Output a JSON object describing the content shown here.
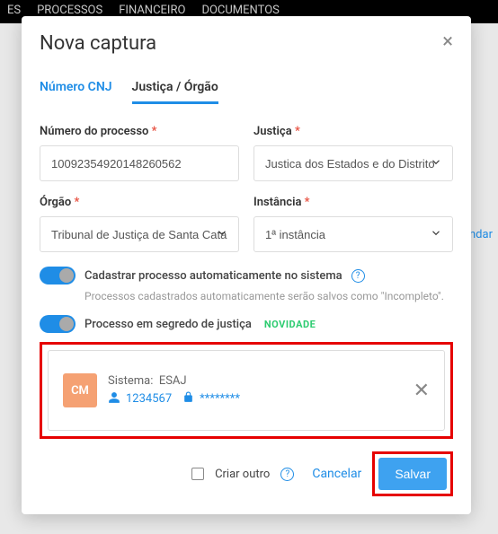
{
  "topnav": {
    "item1": "ES",
    "item2": "PROCESSOS",
    "item3": "FINANCEIRO",
    "item4": "DOCUMENTOS"
  },
  "sideLink": "ndar",
  "modal": {
    "title": "Nova captura",
    "close": "×",
    "tabs": {
      "cnj": "Número CNJ",
      "justica": "Justiça / Órgão"
    },
    "fields": {
      "numero": {
        "label": "Número do processo",
        "value": "10092354920148260562"
      },
      "justica": {
        "label": "Justiça",
        "value": "Justica dos Estados e do Distrito"
      },
      "orgao": {
        "label": "Órgão",
        "value": "Tribunal de Justiça de Santa Cata"
      },
      "instancia": {
        "label": "Instância",
        "value": "1ª instância"
      }
    },
    "toggles": {
      "auto": {
        "label": "Cadastrar processo automaticamente no sistema",
        "hint": "Processos cadastrados automaticamente serão salvos como \"Incompleto\"."
      },
      "segredo": {
        "label": "Processo em segredo de justiça",
        "badge": "NOVIDADE"
      }
    },
    "cred": {
      "avatar": "CM",
      "systemLabel": "Sistema:",
      "systemValue": "ESAJ",
      "user": "1234567",
      "pass": "********"
    },
    "footer": {
      "criarOutro": "Criar outro",
      "cancelar": "Cancelar",
      "salvar": "Salvar"
    }
  }
}
